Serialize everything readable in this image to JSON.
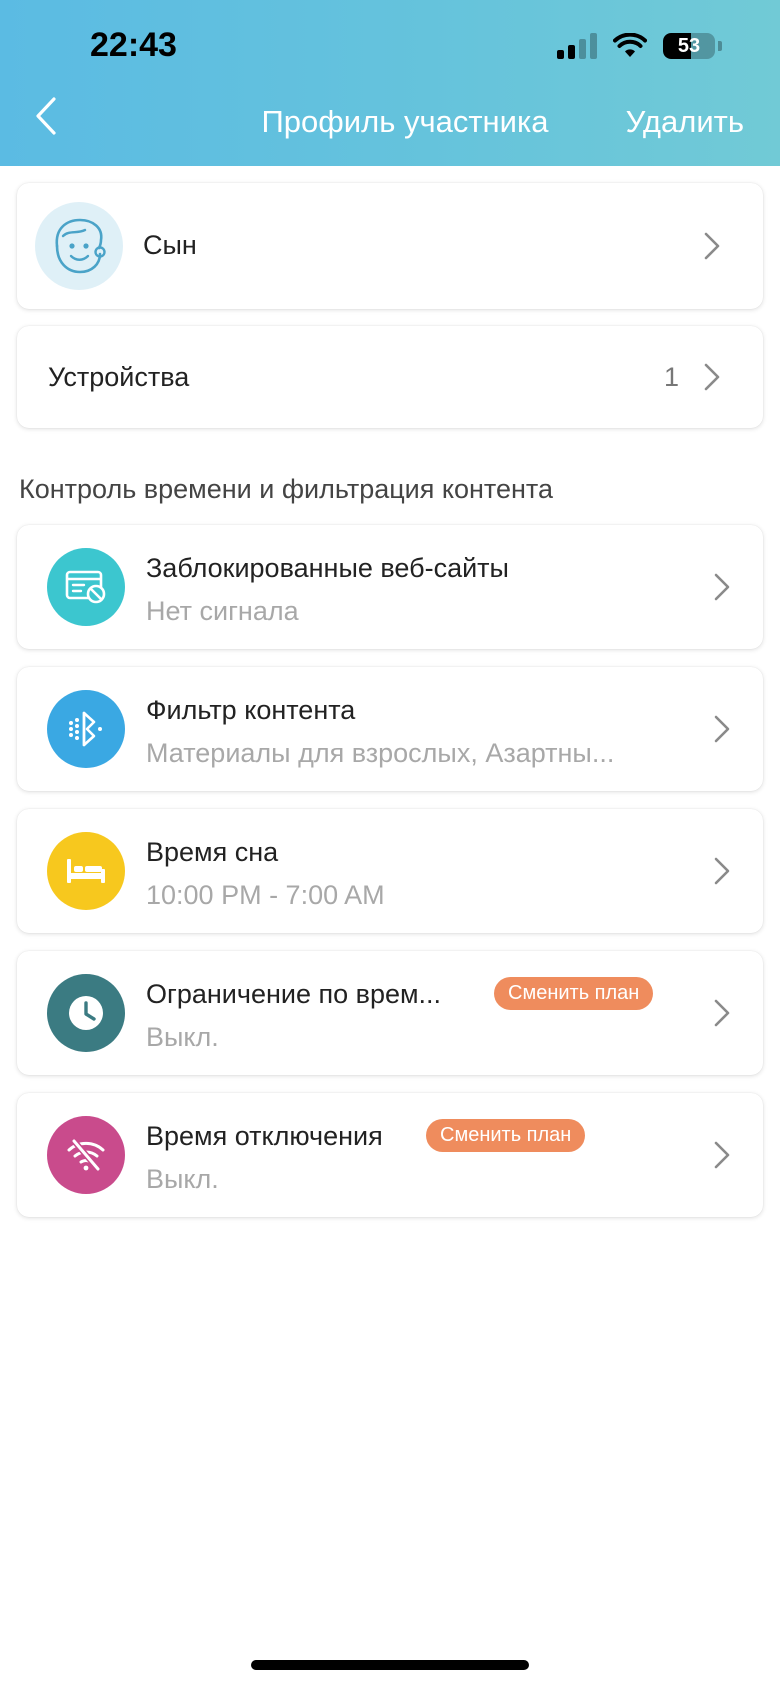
{
  "status_bar": {
    "time": "22:43",
    "battery_percent": "53",
    "battery_level": 0.53
  },
  "nav": {
    "back_icon": "chevron-left-icon",
    "title": "Профиль участника",
    "delete_label": "Удалить"
  },
  "profile": {
    "avatar_icon": "boy-avatar-icon",
    "name": "Сын"
  },
  "devices": {
    "label": "Устройства",
    "count": "1"
  },
  "section_title": "Контроль времени и фильтрация контента",
  "items": [
    {
      "icon": "blocked-websites-icon",
      "icon_color": "#3cc6cf",
      "title": "Заблокированные веб-сайты",
      "subtitle": "Нет сигнала"
    },
    {
      "icon": "content-filter-icon",
      "icon_color": "#3aa8e3",
      "title": "Фильтр контента",
      "subtitle": "Материалы для взрослых, Азартны..."
    },
    {
      "icon": "bed-icon",
      "icon_color": "#f7c81e",
      "title": "Время сна",
      "subtitle": "10:00 PM - 7:00 AM"
    },
    {
      "icon": "clock-icon",
      "icon_color": "#3b7b82",
      "title": "Ограничение по врем...",
      "subtitle": "Выкл.",
      "badge": "Сменить план"
    },
    {
      "icon": "wifi-off-icon",
      "icon_color": "#c94b8c",
      "title": "Время отключения",
      "subtitle": "Выкл.",
      "badge": "Сменить план"
    }
  ],
  "colors": {
    "header_gradient_start": "#5bbbe3",
    "header_gradient_end": "#71cad6",
    "badge": "#ef8c5d"
  }
}
